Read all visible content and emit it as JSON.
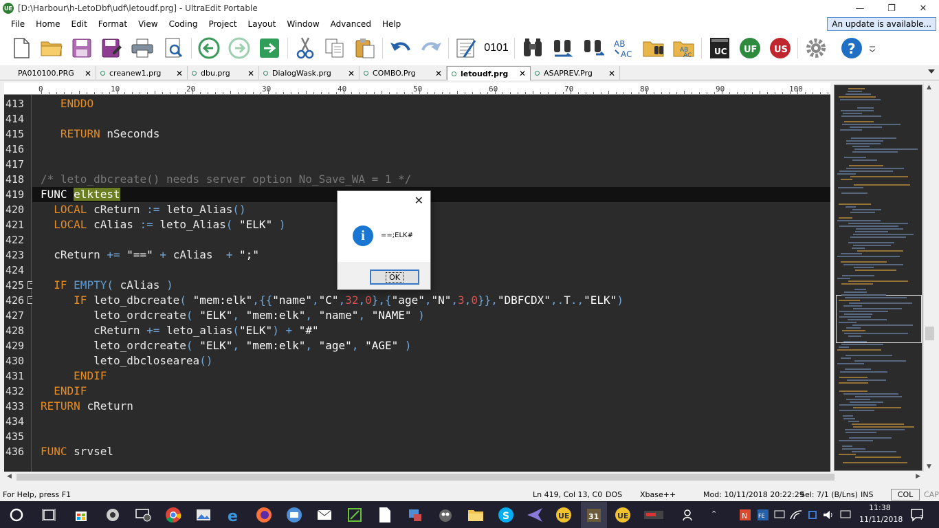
{
  "window": {
    "title": "[D:\\Harbour\\h-LetoDbf\\udf\\letoudf.prg] - UltraEdit Portable",
    "logo": "UE",
    "minimize": "—",
    "maximize": "❐",
    "close": "✕"
  },
  "menu": [
    "File",
    "Home",
    "Edit",
    "Format",
    "View",
    "Coding",
    "Project",
    "Layout",
    "Window",
    "Advanced",
    "Help"
  ],
  "update_notice": "An update is available...",
  "toolbar_icons": [
    "new-file-icon",
    "open-folder-icon",
    "save-icon",
    "save-as-icon",
    "print-icon",
    "print-preview-icon",
    "back-arrow-icon",
    "forward-arrow-icon",
    "goto-icon",
    "cut-icon",
    "copy-icon",
    "paste-icon",
    "undo-icon",
    "redo-icon",
    "column-mode-icon",
    "hex-mode-icon",
    "find-icon",
    "replace-icon",
    "find-in-files-icon",
    "spell-check-icon",
    "replace-in-files-icon",
    "spell-check-files-icon",
    "uc-icon",
    "uf-icon",
    "us-icon",
    "settings-gear-icon",
    "help-icon"
  ],
  "toolbar_labels": {
    "hex": "0101"
  },
  "tabs": [
    {
      "label": "PA010100.PRG",
      "dot": false,
      "active": false
    },
    {
      "label": "creanew1.prg",
      "dot": true,
      "active": false
    },
    {
      "label": "dbu.prg",
      "dot": true,
      "active": false
    },
    {
      "label": "DialogWask.prg",
      "dot": true,
      "active": false
    },
    {
      "label": "COMBO.Prg",
      "dot": true,
      "active": false
    },
    {
      "label": "letoudf.prg",
      "dot": true,
      "active": true
    },
    {
      "label": "ASAPREV.Prg",
      "dot": true,
      "active": false
    }
  ],
  "tab_close": "✕",
  "ruler": {
    "zero": "0",
    "marks": [
      "10",
      "20",
      "30",
      "40",
      "50",
      "60",
      "70",
      "80",
      "90",
      "100"
    ]
  },
  "lines": [
    {
      "n": "413",
      "code": "   ENDDO"
    },
    {
      "n": "414",
      "code": ""
    },
    {
      "n": "415",
      "code": "   RETURN nSeconds"
    },
    {
      "n": "416",
      "code": ""
    },
    {
      "n": "417",
      "code": ""
    },
    {
      "n": "418",
      "code": "/* leto_dbcreate() needs server option No_Save_WA = 1 */"
    },
    {
      "n": "419",
      "code": "FUNC elktest"
    },
    {
      "n": "420",
      "code": "  LOCAL cReturn := leto_Alias()"
    },
    {
      "n": "421",
      "code": "  LOCAL cAlias := leto_Alias( \"ELK\" )"
    },
    {
      "n": "422",
      "code": ""
    },
    {
      "n": "423",
      "code": "  cReturn += \"==\" + cAlias  + \";\""
    },
    {
      "n": "424",
      "code": ""
    },
    {
      "n": "425",
      "code": "  IF EMPTY( cAlias )"
    },
    {
      "n": "426",
      "code": "     IF leto_dbcreate( \"mem:elk\",{{\"name\",\"C\",32,0},{\"age\",\"N\",3,0}},\"DBFCDX\",.T.,\"ELK\")"
    },
    {
      "n": "427",
      "code": "        leto_ordcreate( \"ELK\", \"mem:elk\", \"name\", \"NAME\" )"
    },
    {
      "n": "428",
      "code": "        cReturn += leto_alias(\"ELK\") + \"#\""
    },
    {
      "n": "429",
      "code": "        leto_ordcreate( \"ELK\", \"mem:elk\", \"age\", \"AGE\" )"
    },
    {
      "n": "430",
      "code": "        leto_dbclosearea()"
    },
    {
      "n": "431",
      "code": "     ENDIF"
    },
    {
      "n": "432",
      "code": "  ENDIF"
    },
    {
      "n": "433",
      "code": "RETURN cReturn"
    },
    {
      "n": "434",
      "code": ""
    },
    {
      "n": "435",
      "code": ""
    },
    {
      "n": "436",
      "code": "FUNC srvsel"
    }
  ],
  "current_line": "419",
  "fold_markers": [
    "425",
    "426"
  ],
  "dialog": {
    "close": "✕",
    "icon": "info-icon",
    "icon_glyph": "i",
    "message": "==;ELK#",
    "ok_label": "OK"
  },
  "status": {
    "help": "For Help, press F1",
    "position": "Ln 419, Col 13, C0",
    "line_ending": "DOS",
    "syntax": "Xbase++",
    "modified": "Mod: 10/11/2018 20:22:29",
    "selection": "Sel: 7/1 (B/Lns)",
    "insert": "INS",
    "col": "COL",
    "cap": "CAP"
  },
  "taskbar": {
    "time": "11:38",
    "date": "11/11/2018",
    "notifications": "7",
    "badge_31": "31"
  },
  "colors": {
    "keyword": "#e88c1f",
    "comment": "#777777",
    "number": "#e05050",
    "operator": "#6fa8dc",
    "highlight": "#6b7f22",
    "editor_bg": "#2b2b2b"
  }
}
